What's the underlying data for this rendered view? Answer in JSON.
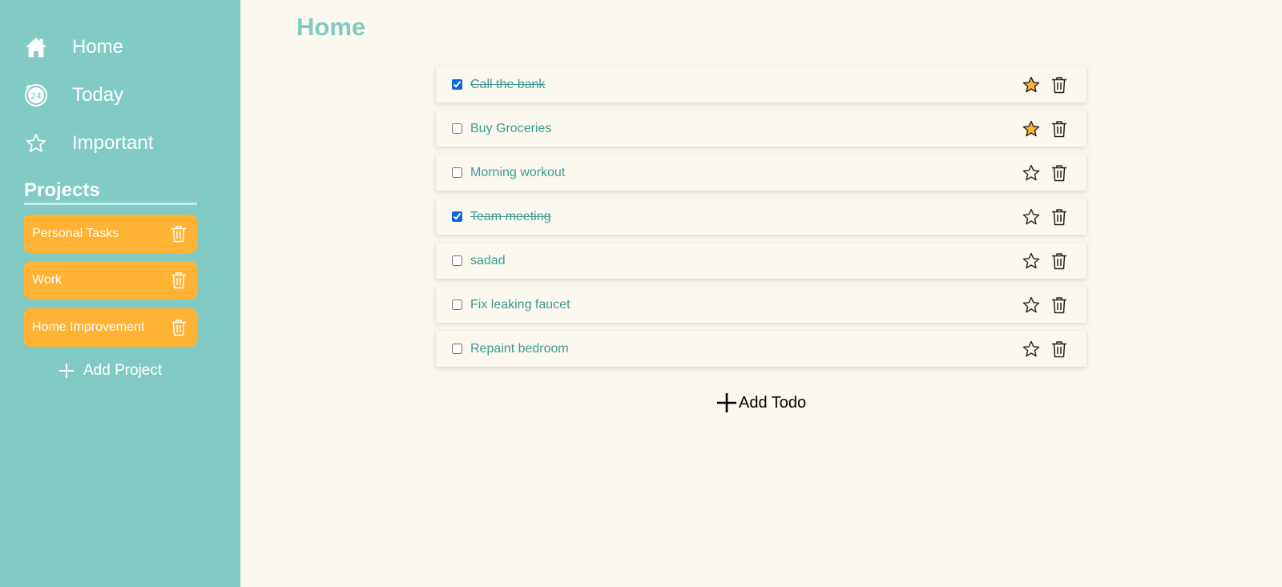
{
  "colors": {
    "sidebar": "#81cbc4",
    "background": "#faf8ef",
    "project": "#ffb234",
    "todo_text": "#3d9b93",
    "star_active": "#ffb234"
  },
  "nav": [
    {
      "label": "Home",
      "icon": "home-icon"
    },
    {
      "label": "Today",
      "icon": "today-24-icon"
    },
    {
      "label": "Important",
      "icon": "star-icon"
    }
  ],
  "projects": {
    "title": "Projects",
    "items": [
      {
        "label": "Personal Tasks"
      },
      {
        "label": "Work"
      },
      {
        "label": "Home Improvement"
      }
    ],
    "add_label": "Add Project"
  },
  "main": {
    "title": "Home",
    "todos": [
      {
        "title": "Call the bank",
        "done": true,
        "important": true
      },
      {
        "title": "Buy Groceries",
        "done": false,
        "important": true
      },
      {
        "title": "Morning workout",
        "done": false,
        "important": false
      },
      {
        "title": "Team meeting",
        "done": true,
        "important": false
      },
      {
        "title": "sadad",
        "done": false,
        "important": false
      },
      {
        "title": "Fix leaking faucet",
        "done": false,
        "important": false
      },
      {
        "title": "Repaint bedroom",
        "done": false,
        "important": false
      }
    ],
    "add_label": "Add Todo"
  }
}
